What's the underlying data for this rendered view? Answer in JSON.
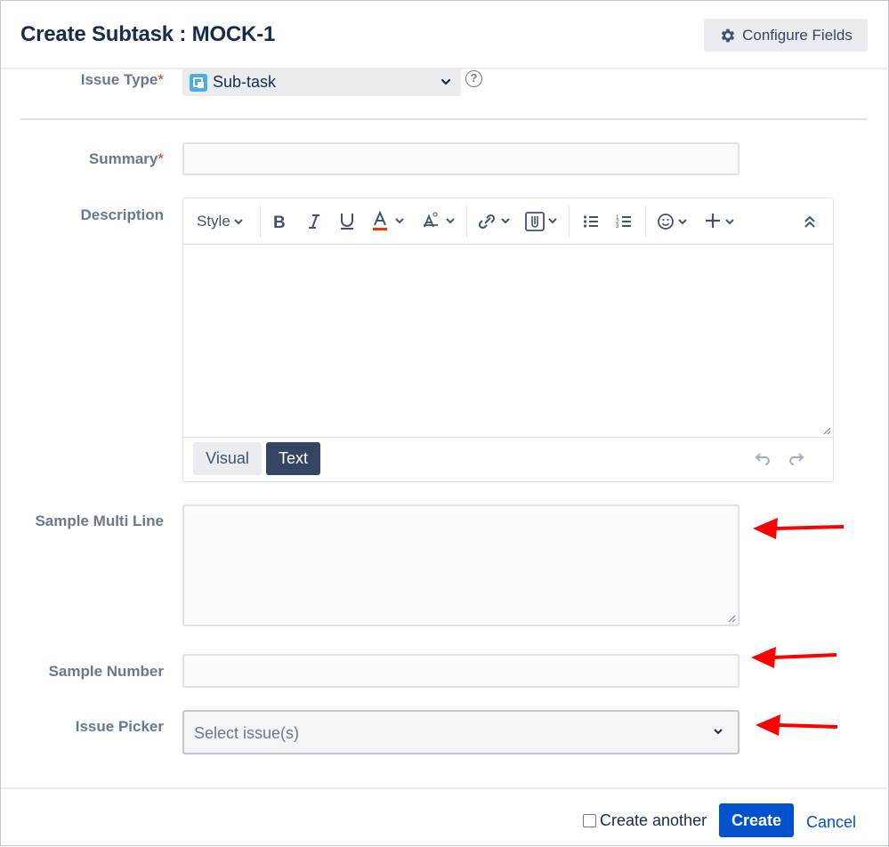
{
  "dialog": {
    "title": "Create Subtask : MOCK-1",
    "configure_label": "Configure Fields"
  },
  "fields": {
    "issue_type": {
      "label": "Issue Type",
      "required_mark": "*",
      "value": "Sub-task",
      "help": "?"
    },
    "summary": {
      "label": "Summary",
      "required_mark": "*",
      "value": ""
    },
    "description": {
      "label": "Description"
    },
    "multi_line": {
      "label": "Sample Multi Line",
      "value": ""
    },
    "number": {
      "label": "Sample Number",
      "value": ""
    },
    "issue_picker": {
      "label": "Issue Picker",
      "placeholder": "Select issue(s)"
    }
  },
  "editor": {
    "style_label": "Style",
    "tools": [
      "bold-icon",
      "italic-icon",
      "underline-icon",
      "text-color-icon",
      "text-format-icon",
      "link-icon",
      "attachment-icon",
      "bullet-list-icon",
      "numbered-list-icon",
      "emoji-icon",
      "insert-icon",
      "collapse-icon"
    ],
    "modes": {
      "visual": "Visual",
      "text": "Text"
    },
    "active_mode": "Text"
  },
  "footer": {
    "create_another_label": "Create another",
    "create_another_checked": false,
    "create_label": "Create",
    "cancel_label": "Cancel"
  },
  "colors": {
    "primary": "#0052cc",
    "required": "#de350b",
    "annotation_arrow": "#ff0000",
    "text_color_bar": "#de350b"
  }
}
